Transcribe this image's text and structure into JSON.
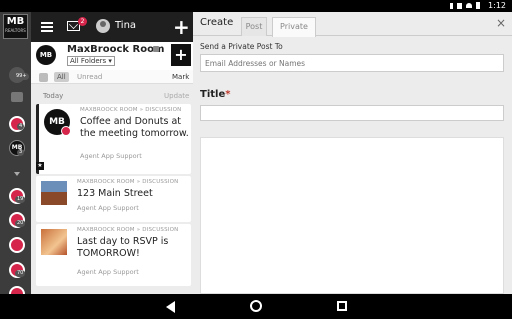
{
  "status_bar": {
    "time": "1:12"
  },
  "rail": {
    "logo_text": "MB",
    "logo_sub": "REALTORS",
    "badges": [
      "99+",
      "4",
      "3",
      "19",
      "20",
      "70"
    ]
  },
  "header": {
    "mail_badge": "2",
    "username": "Tina",
    "plus_label": "+"
  },
  "room": {
    "logo_text": "MB",
    "title": "MaxBroock Room",
    "folder_select": "All Folders",
    "plus_label": "+"
  },
  "filters": {
    "all_label": "All",
    "unread_label": "Unread",
    "mark_label": "Mark"
  },
  "feed": {
    "section_label": "Today",
    "updated_label": "Update",
    "posts": [
      {
        "breadcrumb": "MAXBROOCK ROOM » DISCUSSION",
        "title": "Coffee and Donuts at the meeting tomorrow.",
        "author": "Agent App Support"
      },
      {
        "breadcrumb": "MAXBROOCK ROOM » DISCUSSION",
        "title": "123 Main Street",
        "author": "Agent App Support"
      },
      {
        "breadcrumb": "MAXBROOCK ROOM » DISCUSSION",
        "title": "Last day to RSVP is TOMORROW!",
        "author": "Agent App Support"
      }
    ]
  },
  "create": {
    "heading": "Create",
    "tabs": [
      "Post",
      "Private"
    ],
    "active_tab": "Private",
    "close_label": "×",
    "send_label": "Send a Private Post To",
    "email_placeholder": "Email Addresses or Names",
    "title_label": "Title",
    "required_mark": "*"
  },
  "colors": {
    "badge_red": "#d6254a",
    "rail_bg": "#3c3c3c",
    "panel_bg": "#ececec"
  }
}
